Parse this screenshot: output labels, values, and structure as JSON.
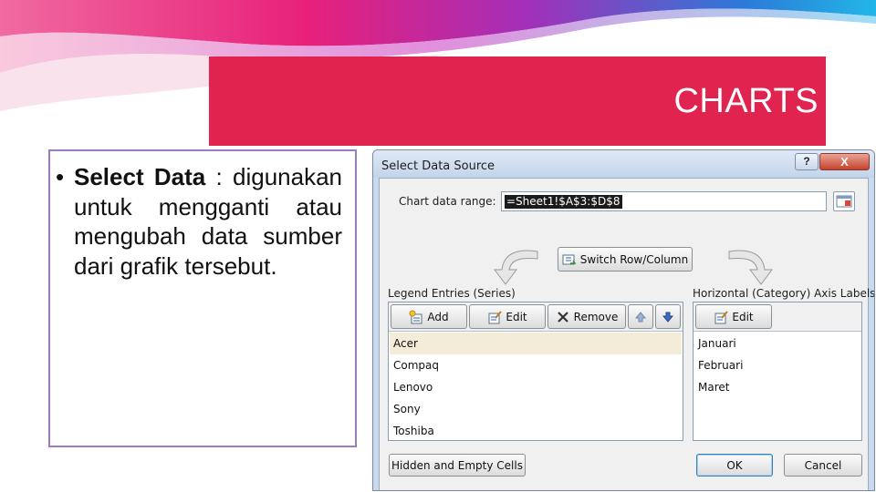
{
  "slide": {
    "title": "CHARTS",
    "bullet_bold": "Select Data",
    "bullet_rest": " : digunakan untuk mengganti atau mengubah data sumber dari grafik tersebut."
  },
  "dialog": {
    "title": "Select Data Source",
    "help_label": "?",
    "close_label": "X",
    "chart_range_label": "Chart data range:",
    "chart_range_value": "=Sheet1!$A$3:$D$8",
    "switch_label": "Switch Row/Column",
    "legend": {
      "label": "Legend Entries (Series)",
      "add_label": "Add",
      "edit_label": "Edit",
      "remove_label": "Remove",
      "entries": [
        "Acer",
        "Compaq",
        "Lenovo",
        "Sony",
        "Toshiba"
      ]
    },
    "axis": {
      "label": "Horizontal (Category) Axis Labels",
      "edit_label": "Edit",
      "entries": [
        "Januari",
        "Februari",
        "Maret"
      ]
    },
    "hidden_cells_label": "Hidden and Empty Cells",
    "ok_label": "OK",
    "cancel_label": "Cancel"
  },
  "colors": {
    "title_banner": "#e1234f",
    "text_box_border": "#9b7bc8",
    "swoosh_pink": "#e8207a",
    "swoosh_blue": "#22b6e8"
  },
  "icons": [
    "switch-row-column-icon",
    "add-icon",
    "edit-icon",
    "remove-icon",
    "move-up-icon",
    "move-down-icon",
    "collapse-dialog-icon"
  ]
}
